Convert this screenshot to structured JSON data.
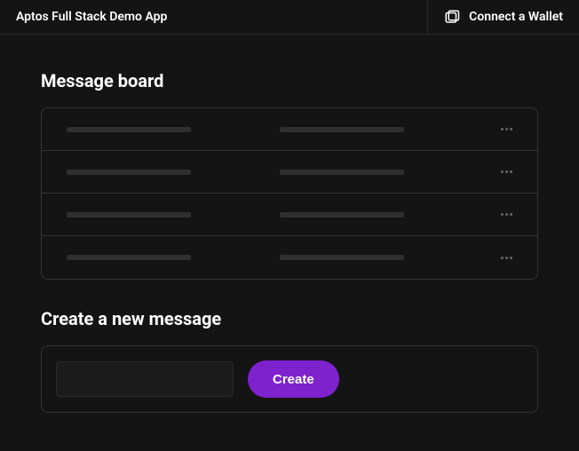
{
  "header": {
    "title": "Aptos Full Stack Demo App",
    "wallet_button": "Connect a Wallet"
  },
  "board": {
    "title": "Message board",
    "rows": 4
  },
  "create": {
    "title": "Create a new message",
    "input_value": "",
    "button_label": "Create"
  },
  "colors": {
    "accent": "#7e22ce"
  }
}
